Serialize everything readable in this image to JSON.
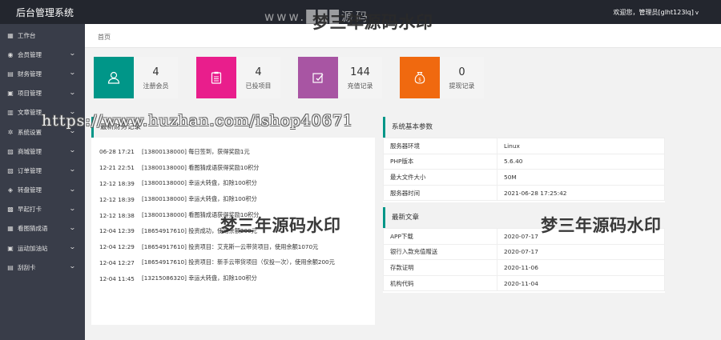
{
  "header": {
    "title": "后台管理系统",
    "user_text": "欢迎您，管理员[glht123lq]",
    "user_caret": "v"
  },
  "sidebar": {
    "items": [
      {
        "label": "工作台",
        "icon": "workbench-icon"
      },
      {
        "label": "会员管理",
        "icon": "member-icon"
      },
      {
        "label": "财务管理",
        "icon": "finance-icon"
      },
      {
        "label": "项目管理",
        "icon": "project-icon"
      },
      {
        "label": "文章管理",
        "icon": "article-icon"
      },
      {
        "label": "系统设置",
        "icon": "gear-icon"
      },
      {
        "label": "商城管理",
        "icon": "shop-icon"
      },
      {
        "label": "订单管理",
        "icon": "order-icon"
      },
      {
        "label": "转盘管理",
        "icon": "wheel-icon"
      },
      {
        "label": "早起打卡",
        "icon": "checkin-icon"
      },
      {
        "label": "看图猜成语",
        "icon": "idiom-icon"
      },
      {
        "label": "运动加油站",
        "icon": "sport-icon"
      },
      {
        "label": "刮刮卡",
        "icon": "scratch-icon"
      }
    ]
  },
  "breadcrumb": "首页",
  "stats": [
    {
      "value": "4",
      "label": "注册会员",
      "color": "#009688",
      "icon": "user-icon"
    },
    {
      "value": "4",
      "label": "已投项目",
      "color": "#e91e8c",
      "icon": "clipboard-icon"
    },
    {
      "value": "144",
      "label": "充值记录",
      "color": "#a855a3",
      "icon": "edit-icon"
    },
    {
      "value": "0",
      "label": "提现记录",
      "color": "#f0690f",
      "icon": "money-bag-icon"
    }
  ],
  "funds": {
    "title": "最新财务记录",
    "rows": [
      {
        "time": "06-28 17:21",
        "text": "[13800138000] 每日签到，获得奖励1元"
      },
      {
        "time": "12-21 22:51",
        "text": "[13800138000] 看图猜成语获得奖励10积分"
      },
      {
        "time": "12-12 18:39",
        "text": "[13800138000] 幸运大转盘，扣除100积分"
      },
      {
        "time": "12-12 18:39",
        "text": "[13800138000] 幸运大转盘，扣除100积分"
      },
      {
        "time": "12-12 18:38",
        "text": "[13800138000] 看图猜成语获得奖励10积分"
      },
      {
        "time": "12-04 12:39",
        "text": "[18654917610] 投资成功，使用余额200元"
      },
      {
        "time": "12-04 12:29",
        "text": "[18654917610] 投资项目：艾克斯一云带货项目，使用余额1070元"
      },
      {
        "time": "12-04 12:27",
        "text": "[18654917610] 投资项目：新手云带货项目（仅投一次），使用余额200元"
      },
      {
        "time": "12-04 11:45",
        "text": "[13215086320] 幸运大转盘，扣除100积分"
      }
    ]
  },
  "system": {
    "title": "系统基本参数",
    "rows": [
      {
        "k": "服务器环境",
        "v": "Linux"
      },
      {
        "k": "PHP版本",
        "v": "5.6.40"
      },
      {
        "k": "最大文件大小",
        "v": "50M"
      },
      {
        "k": "服务器时间",
        "v": "2021-06-28 17:25:42"
      }
    ]
  },
  "articles": {
    "title": "最新文章",
    "rows": [
      {
        "k": "APP下载",
        "v": "2020-07-17"
      },
      {
        "k": "银行入款充值赠送",
        "v": "2020-07-17"
      },
      {
        "k": "存款证明",
        "v": "2020-11-06"
      },
      {
        "k": "机构代码",
        "v": "2020-11-04"
      }
    ]
  },
  "watermarks": {
    "main": "梦三年源码水印",
    "url": "https://www.huzhan.com/ishop40671",
    "faint": "www.███源码"
  }
}
